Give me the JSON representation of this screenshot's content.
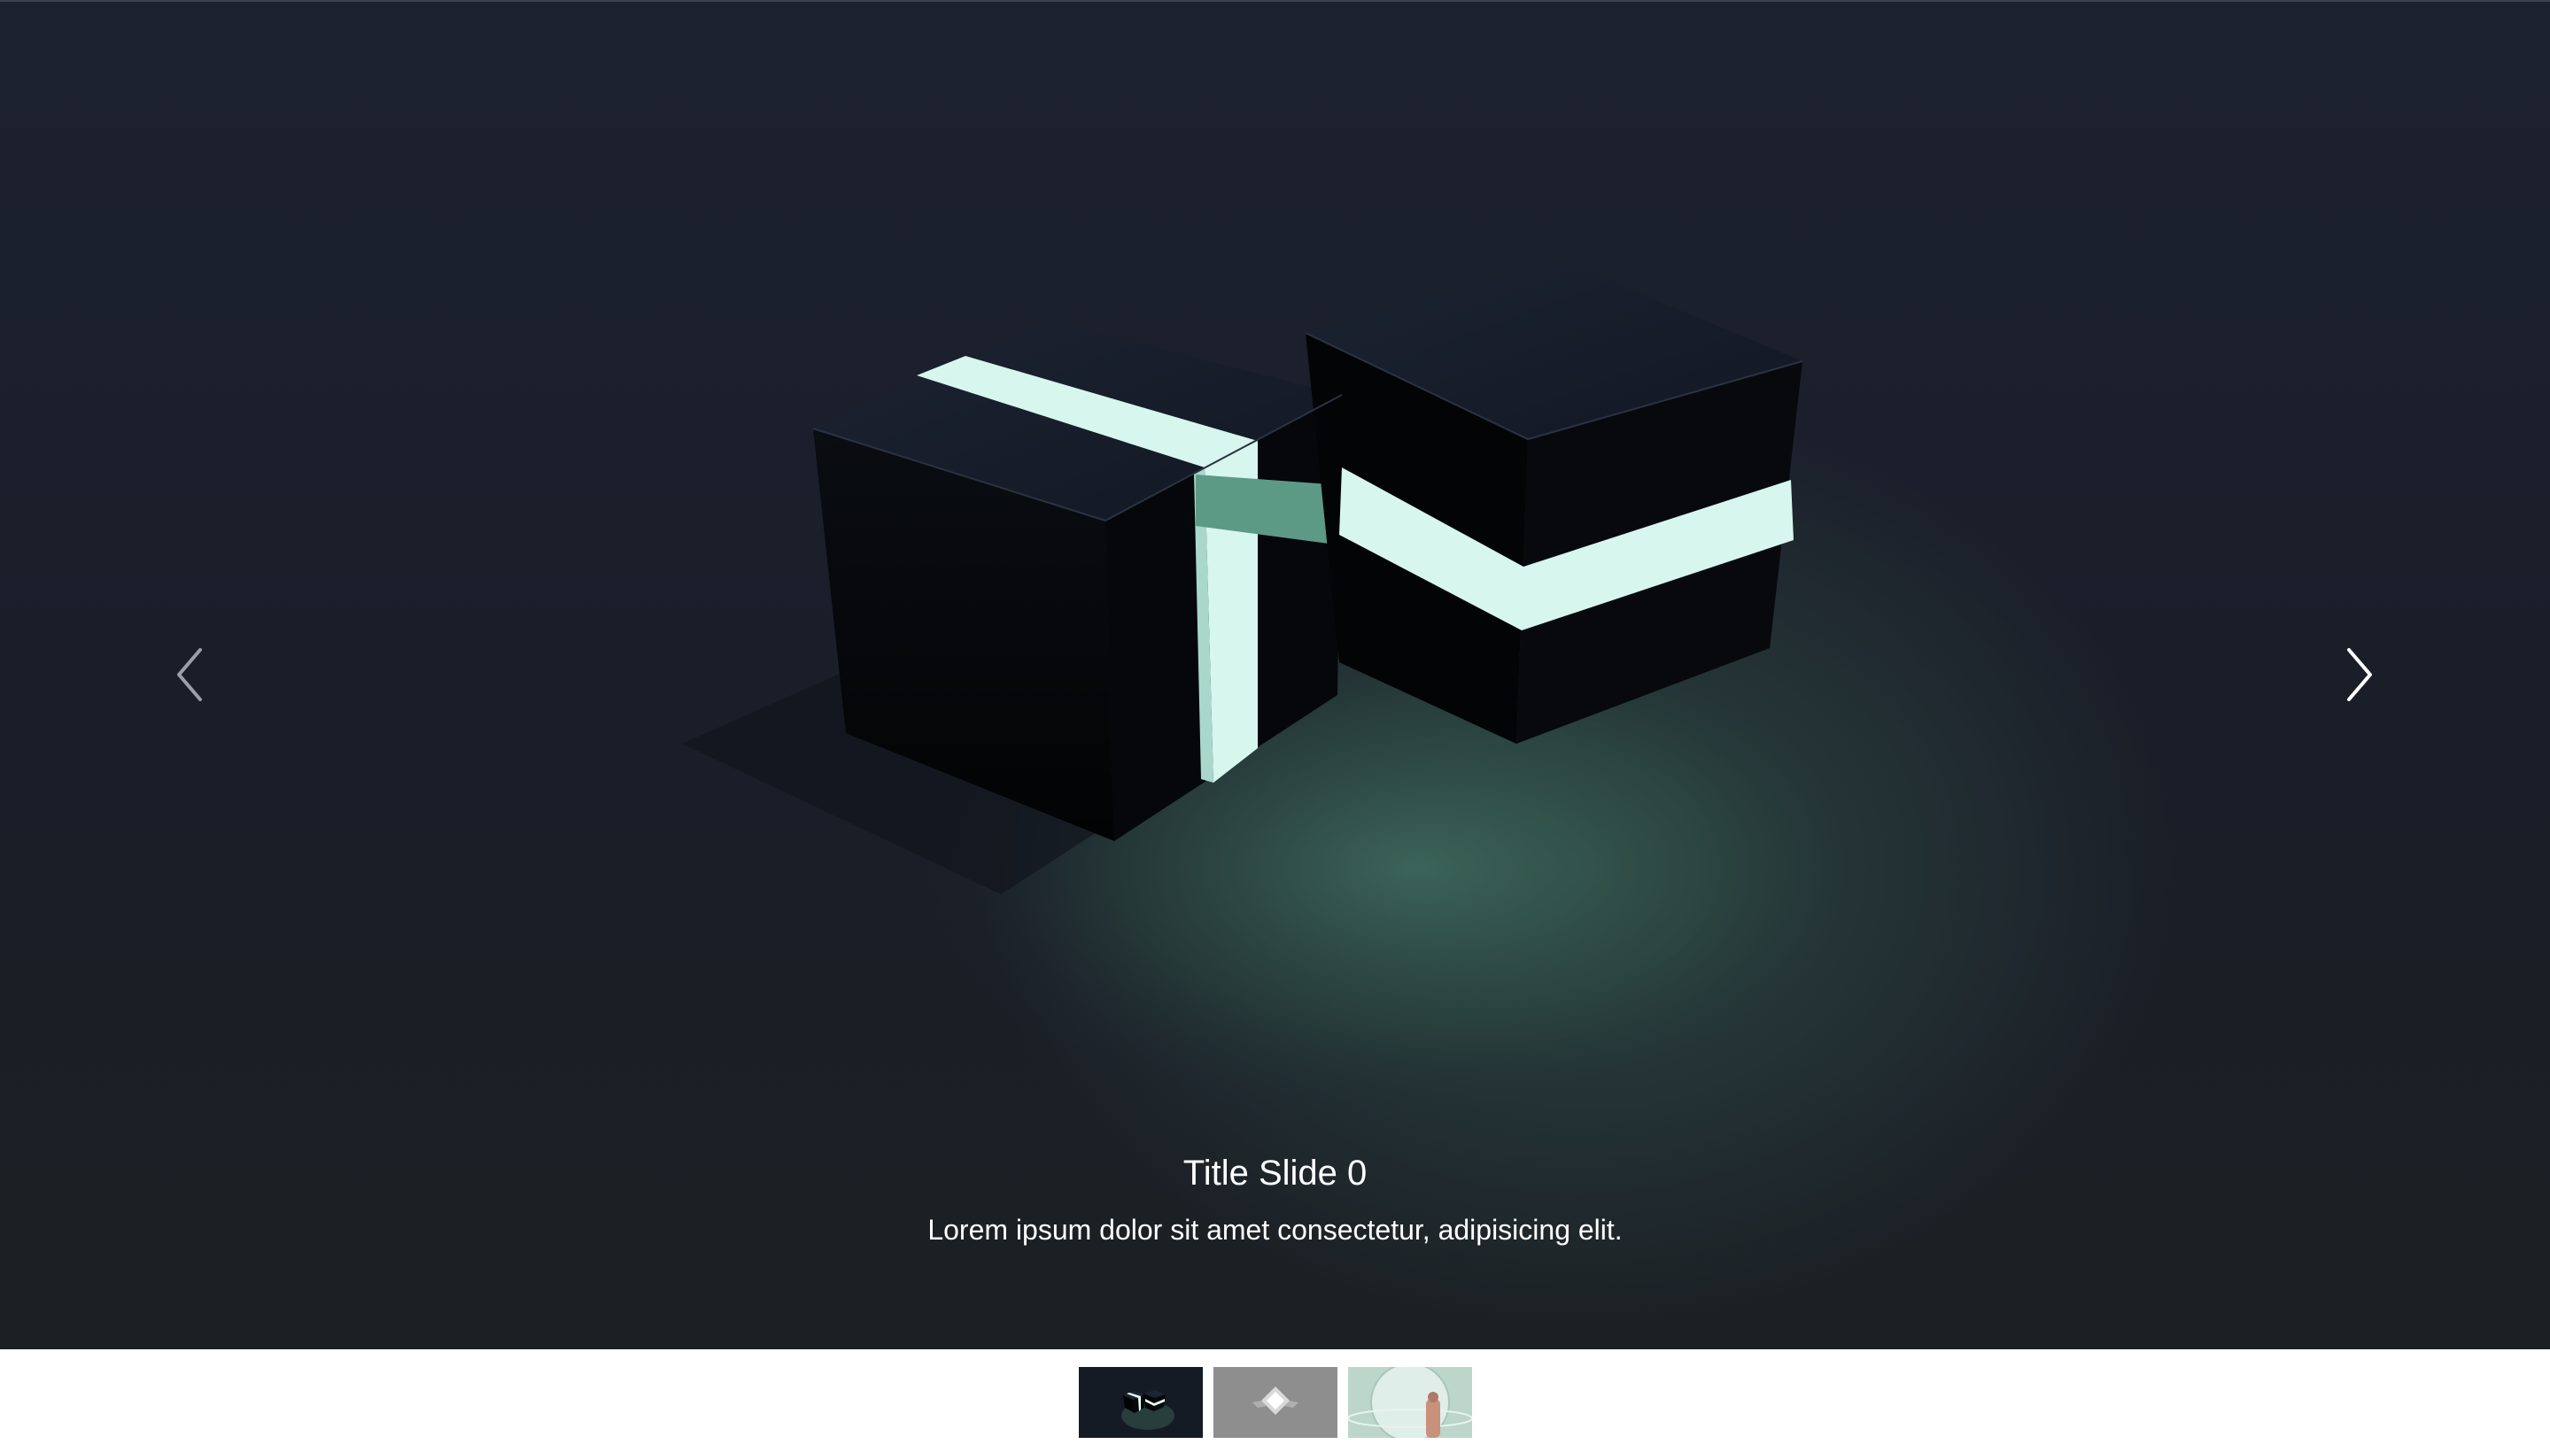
{
  "slide": {
    "title": "Title Slide 0",
    "description": "Lorem ipsum dolor sit amet consectetur, adipisicing elit."
  },
  "navigation": {
    "prev_icon": "chevron-left-icon",
    "next_icon": "chevron-right-icon"
  },
  "thumbnails": [
    {
      "name": "thumbnail-0",
      "active": true
    },
    {
      "name": "thumbnail-1",
      "active": false
    },
    {
      "name": "thumbnail-2",
      "active": false
    }
  ],
  "colors": {
    "background": "#1c2130",
    "glow": "#d7f6ee",
    "caption_text": "#ffffff"
  }
}
